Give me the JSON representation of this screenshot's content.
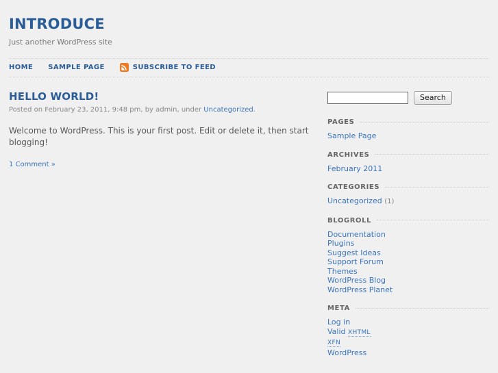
{
  "header": {
    "site_title": "INTRODUCE",
    "tagline": "Just another WordPress site"
  },
  "nav": {
    "items": [
      {
        "label": "HOME",
        "name": "nav-item-home",
        "icon": null
      },
      {
        "label": "SAMPLE PAGE",
        "name": "nav-item-sample-page",
        "icon": null
      },
      {
        "label": "SUBSCRIBE TO FEED",
        "name": "nav-item-subscribe-to-feed",
        "icon": "rss-icon"
      }
    ]
  },
  "post": {
    "title": "HELLO WORLD!",
    "meta_prefix": "Posted on February 23, 2011, 9:48 pm, by admin, under ",
    "meta_category": "Uncategorized",
    "meta_suffix": ".",
    "content": "Welcome to WordPress. This is your first post. Edit or delete it, then start blogging!",
    "comments_link": "1 Comment »"
  },
  "sidebar": {
    "search": {
      "value": "",
      "placeholder": "",
      "button_label": "Search"
    },
    "widgets": [
      {
        "title": "PAGES",
        "name": "widget-pages",
        "items": [
          {
            "label": "Sample Page",
            "count": ""
          }
        ]
      },
      {
        "title": "ARCHIVES",
        "name": "widget-archives",
        "items": [
          {
            "label": "February 2011",
            "count": ""
          }
        ]
      },
      {
        "title": "CATEGORIES",
        "name": "widget-categories",
        "items": [
          {
            "label": "Uncategorized",
            "count": "(1)"
          }
        ]
      },
      {
        "title": "BLOGROLL",
        "name": "widget-blogroll",
        "items": [
          {
            "label": "Documentation",
            "count": ""
          },
          {
            "label": "Plugins",
            "count": ""
          },
          {
            "label": "Suggest Ideas",
            "count": ""
          },
          {
            "label": "Support Forum",
            "count": ""
          },
          {
            "label": "Themes",
            "count": ""
          },
          {
            "label": "WordPress Blog",
            "count": ""
          },
          {
            "label": "WordPress Planet",
            "count": ""
          }
        ]
      }
    ],
    "meta_widget": {
      "title": "META",
      "items": [
        {
          "label": "Log in",
          "abbr_prefix": "",
          "abbr": ""
        },
        {
          "label": "",
          "abbr_prefix": "Valid ",
          "abbr": "XHTML"
        },
        {
          "label": "",
          "abbr_prefix": "",
          "abbr": "XFN"
        },
        {
          "label": "WordPress",
          "abbr_prefix": "",
          "abbr": ""
        }
      ]
    }
  },
  "colors": {
    "page_background": "#f0f0f0",
    "title_blue": "#2a5c98",
    "link_blue": "#3a74ba",
    "body_text": "#595959",
    "muted_text": "#888888",
    "rss_orange": "#ee7b22"
  }
}
